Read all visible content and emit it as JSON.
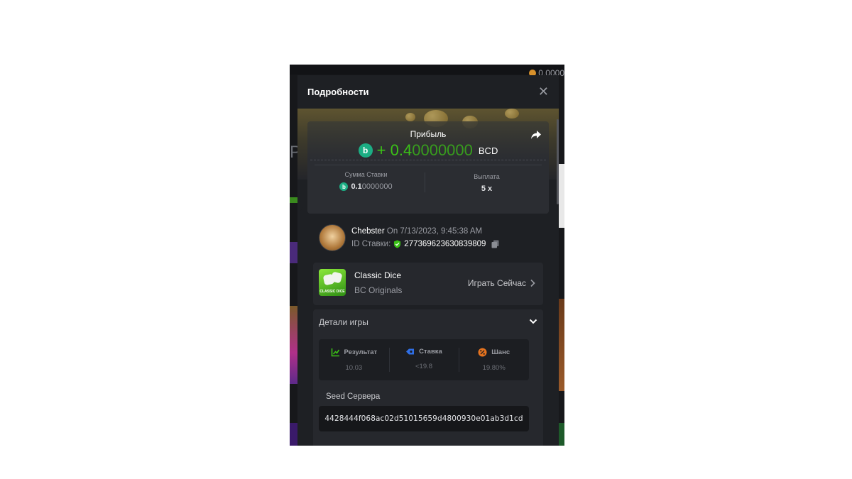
{
  "background": {
    "balance": "0.0000",
    "letter": "P"
  },
  "modal": {
    "title": "Подробности",
    "close_icon": "close-icon"
  },
  "profit": {
    "label": "Прибыль",
    "sign": "+",
    "amount_bright": "0.4",
    "amount_dim": "0000000",
    "currency": "BCD",
    "coin_letter": "b",
    "share_icon": "share-icon"
  },
  "bet_amount": {
    "label": "Сумма Ставки",
    "value_bold": "0.1",
    "value_dim": "0000000"
  },
  "payout": {
    "label": "Выплата",
    "value": "5 x"
  },
  "user": {
    "name": "Chebster",
    "time": "On 7/13/2023, 9:45:38 AM",
    "bet_id_label": "ID Ставки:",
    "bet_id": "277369623630839809"
  },
  "game": {
    "name": "Classic Dice",
    "provider": "BC Originals",
    "play_label": "Играть Сейчас",
    "thumb_text": "CLASSIC DICE"
  },
  "details": {
    "title": "Детали игры",
    "cells": [
      {
        "label": "Результат",
        "value": "10.03",
        "color": "#3bc117"
      },
      {
        "label": "Ставка",
        "value": "<19.8",
        "color": "#2f6fe6"
      },
      {
        "label": "Шанс",
        "value": "19.80%",
        "color": "#e5731f"
      }
    ],
    "seed_label": "Seed Сервера",
    "seed_value": "4428444f068ac02d51015659d4800930e01ab3d1cd"
  }
}
